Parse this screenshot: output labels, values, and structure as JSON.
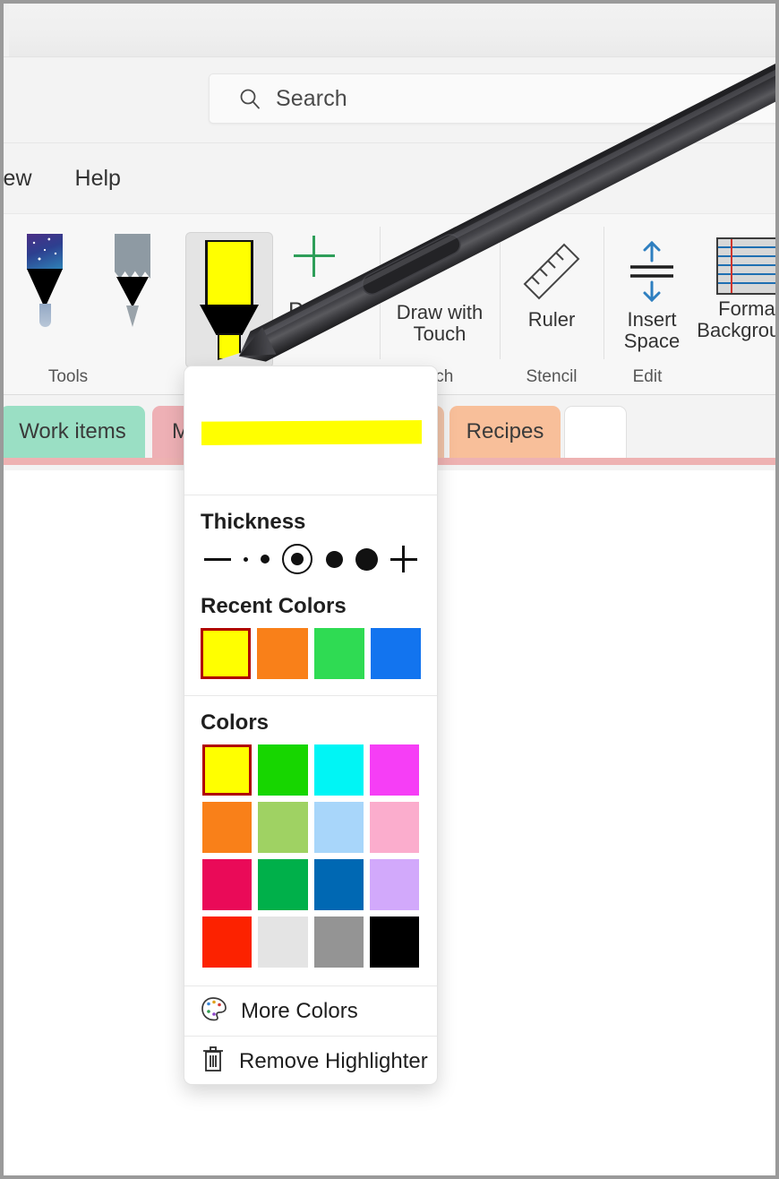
{
  "window": {
    "title": ""
  },
  "search": {
    "placeholder": "Search",
    "icon": "search-icon"
  },
  "menubar": {
    "items": [
      {
        "label": "iew"
      },
      {
        "label": "Help"
      }
    ]
  },
  "ribbon": {
    "groups": [
      {
        "label": "Tools"
      },
      {
        "label": "uch"
      },
      {
        "label": "Stencil"
      },
      {
        "label": "Edit"
      }
    ],
    "tools": [
      {
        "name": "galaxy-pen",
        "caption": ""
      },
      {
        "name": "pencil",
        "caption": ""
      },
      {
        "name": "highlighter",
        "caption": "",
        "selected": true
      },
      {
        "name": "add-pen",
        "caption": ""
      },
      {
        "name": "pen-dropdown",
        "caption": "Pen"
      },
      {
        "name": "draw-with-touch",
        "caption": "Draw with Touch"
      },
      {
        "name": "ruler",
        "caption": "Ruler"
      },
      {
        "name": "insert-space",
        "caption": "Insert Space"
      },
      {
        "name": "format-background",
        "caption": "Format Background"
      }
    ]
  },
  "tabs": [
    {
      "label": "Work items",
      "color": "#9adfc4"
    },
    {
      "label": "M",
      "color": "#eeb0b5"
    },
    {
      "label": "Recipes",
      "color": "#f8bf9a"
    },
    {
      "label": "",
      "color": "#ffffff"
    }
  ],
  "panel": {
    "preview_color": "#ffff00",
    "thickness": {
      "heading": "Thickness",
      "options": [
        {
          "name": "decrease",
          "size": 0
        },
        {
          "name": "size-1",
          "size": 4
        },
        {
          "name": "size-2",
          "size": 9
        },
        {
          "name": "size-3",
          "size": 13,
          "selected": true
        },
        {
          "name": "size-4",
          "size": 18
        },
        {
          "name": "size-5",
          "size": 24
        },
        {
          "name": "increase",
          "size": 0
        }
      ]
    },
    "recent_colors": {
      "heading": "Recent Colors",
      "swatches": [
        {
          "name": "yellow",
          "hex": "#ffff00",
          "selected": true
        },
        {
          "name": "orange",
          "hex": "#f98019"
        },
        {
          "name": "green",
          "hex": "#2fdb53"
        },
        {
          "name": "blue",
          "hex": "#1274ef"
        }
      ]
    },
    "colors": {
      "heading": "Colors",
      "rows": [
        [
          {
            "name": "yellow",
            "hex": "#ffff00",
            "selected": true
          },
          {
            "name": "green",
            "hex": "#17d600"
          },
          {
            "name": "cyan",
            "hex": "#00f5f5"
          },
          {
            "name": "magenta",
            "hex": "#f63ef6"
          }
        ],
        [
          {
            "name": "orange",
            "hex": "#f98019"
          },
          {
            "name": "light-green",
            "hex": "#9fd263"
          },
          {
            "name": "light-blue",
            "hex": "#a8d6fa"
          },
          {
            "name": "pink",
            "hex": "#fbadcd"
          }
        ],
        [
          {
            "name": "crimson",
            "hex": "#ea0a58"
          },
          {
            "name": "emerald",
            "hex": "#00b04a"
          },
          {
            "name": "blue",
            "hex": "#0068b3"
          },
          {
            "name": "lavender",
            "hex": "#d2a9fb"
          }
        ],
        [
          {
            "name": "red",
            "hex": "#fc2200"
          },
          {
            "name": "light-gray",
            "hex": "#e4e4e4"
          },
          {
            "name": "gray",
            "hex": "#949494"
          },
          {
            "name": "black",
            "hex": "#000000"
          }
        ]
      ]
    },
    "actions": [
      {
        "name": "more-colors",
        "label": "More Colors",
        "icon": "palette-icon"
      },
      {
        "name": "remove-highlighter",
        "label": "Remove Highlighter",
        "icon": "trash-icon"
      }
    ]
  }
}
